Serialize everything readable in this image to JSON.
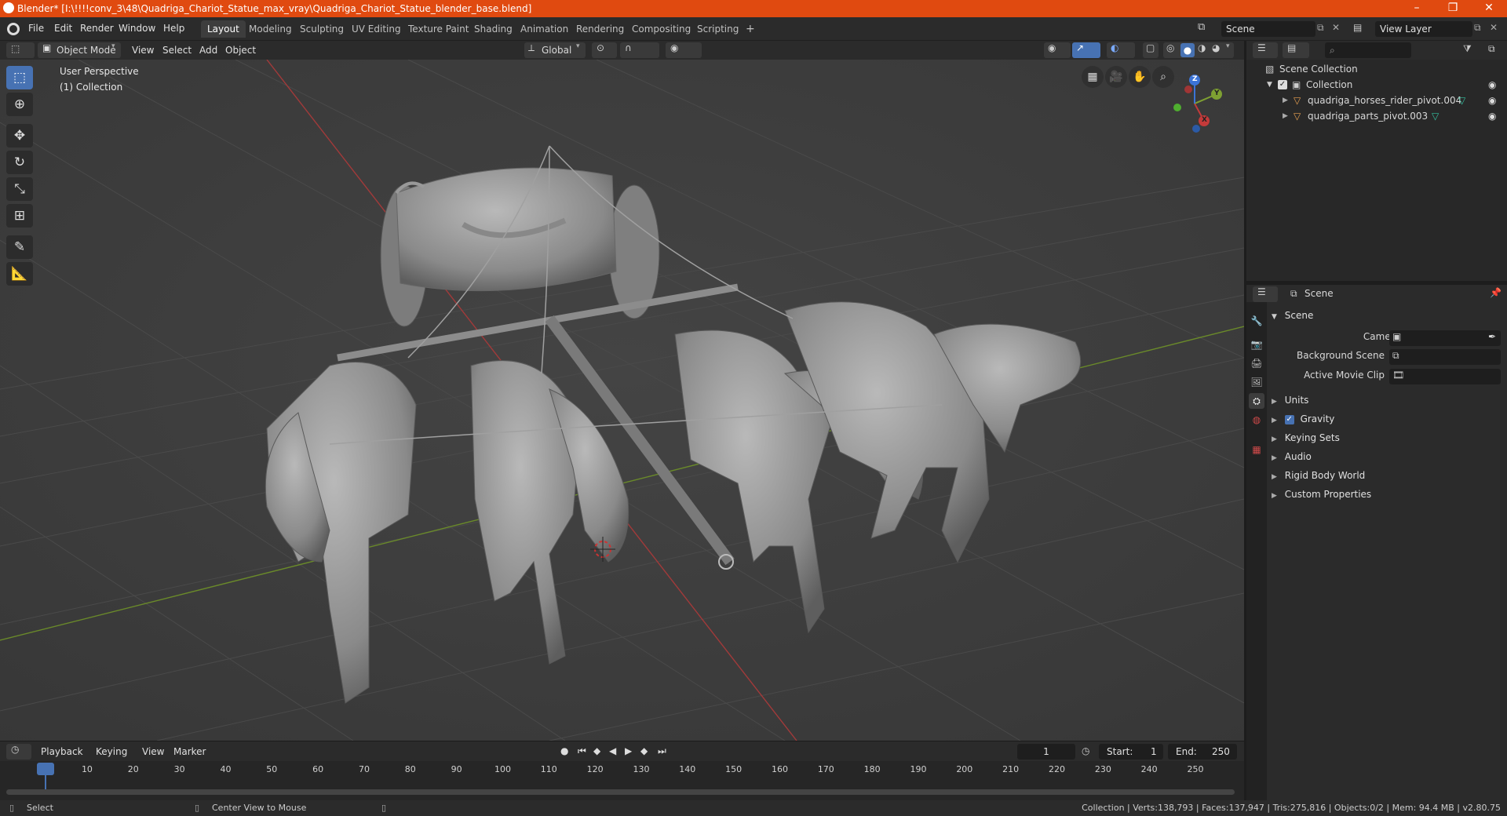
{
  "window": {
    "title": "Blender* [I:\\!!!!conv_3\\48\\Quadriga_Chariot_Statue_max_vray\\Quadriga_Chariot_Statue_blender_base.blend]",
    "minimize": "–",
    "maximize": "❐",
    "close": "✕"
  },
  "menu": {
    "items": [
      "File",
      "Edit",
      "Render",
      "Window",
      "Help"
    ]
  },
  "workspaces": {
    "tabs": [
      "Layout",
      "Modeling",
      "Sculpting",
      "UV Editing",
      "Texture Paint",
      "Shading",
      "Animation",
      "Rendering",
      "Compositing",
      "Scripting"
    ],
    "active": "Layout",
    "add": "+"
  },
  "scene_selector": {
    "value": "Scene"
  },
  "view_layer_selector": {
    "value": "View Layer"
  },
  "viewport_header": {
    "mode": "Object Mode",
    "menus": [
      "View",
      "Select",
      "Add",
      "Object"
    ],
    "orientation": "Global"
  },
  "viewport": {
    "perspective_label": "User Perspective",
    "collection_label": "(1) Collection",
    "gizmo": {
      "x": "X",
      "y": "Y",
      "z": "Z"
    }
  },
  "outliner": {
    "search_placeholder": "",
    "root": "Scene Collection",
    "collection": "Collection",
    "objects": [
      "quadriga_horses_rider_pivot.004",
      "quadriga_parts_pivot.003"
    ]
  },
  "properties": {
    "header_title": "Scene",
    "section": "Scene",
    "camera_label": "Camera",
    "background_scene_label": "Background Scene",
    "active_movie_clip_label": "Active Movie Clip",
    "panels": [
      "Units",
      "Gravity",
      "Keying Sets",
      "Audio",
      "Rigid Body World",
      "Custom Properties"
    ],
    "gravity_checked": true
  },
  "timeline": {
    "menus": [
      "Playback",
      "Keying",
      "View",
      "Marker"
    ],
    "current_frame": "1",
    "start_label": "Start:",
    "start_value": "1",
    "end_label": "End:",
    "end_value": "250",
    "ticks": [
      "1",
      "10",
      "20",
      "30",
      "40",
      "50",
      "60",
      "70",
      "80",
      "90",
      "100",
      "110",
      "120",
      "130",
      "140",
      "150",
      "160",
      "170",
      "180",
      "190",
      "200",
      "210",
      "220",
      "230",
      "240",
      "250"
    ]
  },
  "statusbar": {
    "left_action": "Select",
    "middle_action": "Center View to Mouse",
    "stats": "Collection | Verts:138,793 | Faces:137,947 | Tris:275,816 | Objects:0/2 | Mem: 94.4 MB | v2.80.75"
  },
  "colors": {
    "titlebar": "#e04a10",
    "accent": "#4772b3",
    "axis_x": "#c33a3a",
    "axis_y": "#7ea032",
    "axis_z": "#3b73d6"
  }
}
